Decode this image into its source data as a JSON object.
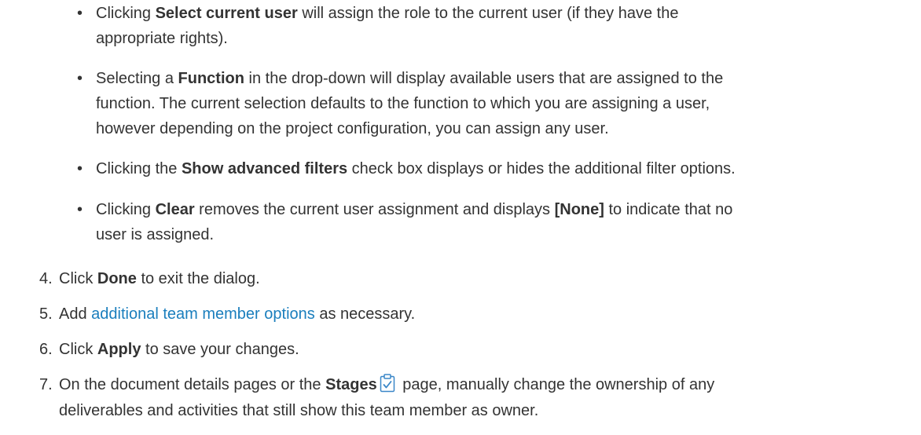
{
  "bullets": [
    {
      "lines": [
        {
          "pre": "Clicking ",
          "bold": "Select current user",
          "post": " will assign the role to the current user (if they have the"
        },
        {
          "text": "appropriate rights)."
        }
      ]
    },
    {
      "lines": [
        {
          "pre": "Selecting a ",
          "bold": "Function",
          "post": " in the drop-down will display available users that are assigned to the"
        },
        {
          "text": "function. The current selection defaults to the function to which you are assigning a user,"
        },
        {
          "text": "however depending on the project configuration, you can assign any user."
        }
      ]
    },
    {
      "lines": [
        {
          "pre": "Clicking the ",
          "bold": "Show advanced filters",
          "post": " check box displays or hides the additional filter options."
        }
      ]
    },
    {
      "lines": [
        {
          "pre": "Clicking ",
          "bold": "Clear",
          "mid": " removes the current user assignment and displays ",
          "bold2": "[None]",
          "post": " to indicate that no"
        },
        {
          "text": "user is assigned."
        }
      ]
    }
  ],
  "steps": [
    {
      "num": "4.",
      "pre": "Click ",
      "bold": "Done",
      "post": " to exit the dialog."
    },
    {
      "num": "5.",
      "pre": "Add ",
      "link": "additional team member options",
      "post": " as necessary."
    },
    {
      "num": "6.",
      "pre": "Click ",
      "bold": "Apply",
      "post": " to save your changes."
    },
    {
      "num": "7.",
      "pre": "On the document details pages or the ",
      "bold": "Stages",
      "post": " page, manually change the ownership of any",
      "cont": "deliverables and activities that still show this team member as owner."
    }
  ],
  "icons": {
    "stages": "clipboard-check-icon"
  },
  "colors": {
    "text": "#333333",
    "link": "#1a7ebd",
    "icon": "#3a87c8"
  }
}
